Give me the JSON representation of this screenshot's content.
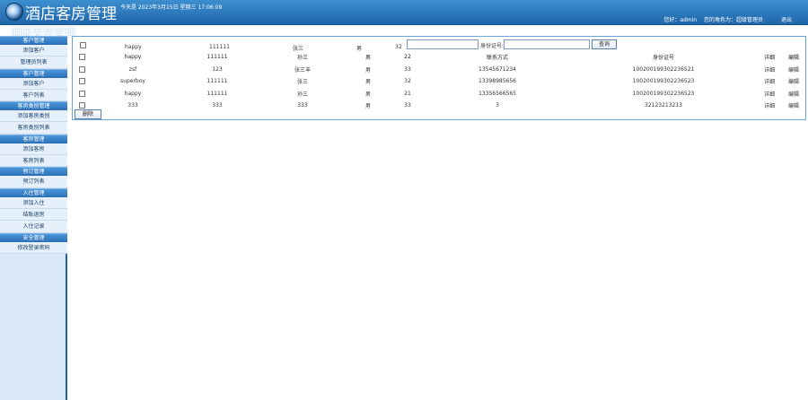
{
  "header": {
    "title": "酒店客房管理",
    "date_text": "今天是 2023年3月15日 星期三 17:06:09",
    "welcome": "您好：admin",
    "role": "您的角色为：超级管理员",
    "logout": "退出",
    "subtitle": "酒店客房管理"
  },
  "sidebar": {
    "groups": [
      {
        "title": "客户管理",
        "items": [
          "添加客户",
          "管理员列表"
        ]
      },
      {
        "title": "客户管理",
        "items": [
          "添加客户",
          "客户列表"
        ]
      },
      {
        "title": "客房类别管理",
        "items": [
          "添加客房类别",
          "客房类别列表"
        ]
      },
      {
        "title": "客房管理",
        "items": [
          "添加客房",
          "客房列表"
        ]
      },
      {
        "title": "预订管理",
        "items": [
          "预订列表"
        ]
      },
      {
        "title": "入住管理",
        "items": [
          "添加入住",
          "结账退房",
          "入住记录"
        ]
      },
      {
        "title": "安全管理",
        "items": [
          "修改登录密码"
        ]
      }
    ]
  },
  "search": {
    "id_label": "身份证号:",
    "query_button": "查询"
  },
  "table": {
    "ghost_row": [
      "happy",
      "111111",
      "张三",
      "男",
      "32"
    ],
    "headers": [
      "",
      "happy",
      "111111",
      "孙三",
      "男",
      "22",
      "联系方式",
      "身份证号",
      "详细",
      "编辑"
    ],
    "rows": [
      [
        "zsf",
        "123",
        "张三丰",
        "男",
        "33",
        "13545671234",
        "100200199302236521",
        "详细",
        "编辑"
      ],
      [
        "superboy",
        "111111",
        "张三",
        "男",
        "32",
        "13398985656",
        "100200199302236523",
        "详细",
        "编辑"
      ],
      [
        "happy",
        "111111",
        "孙三",
        "男",
        "21",
        "13356566565",
        "100200199302236523",
        "详细",
        "编辑"
      ],
      [
        "333",
        "333",
        "333",
        "男",
        "33",
        "3",
        "32123213213",
        "详细",
        "编辑"
      ]
    ]
  },
  "actions": {
    "delete": "删除"
  }
}
